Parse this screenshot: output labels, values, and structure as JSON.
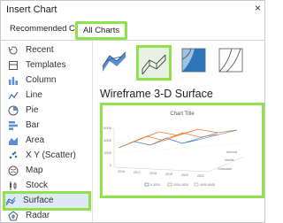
{
  "dialog": {
    "title": "Insert Chart",
    "close": "×"
  },
  "tabs": {
    "recommended": "Recommended Charts",
    "all": "All Charts"
  },
  "sidebar": {
    "items": [
      {
        "label": "Recent",
        "icon": "recent-icon"
      },
      {
        "label": "Templates",
        "icon": "templates-icon"
      },
      {
        "label": "Column",
        "icon": "column-chart-icon"
      },
      {
        "label": "Line",
        "icon": "line-chart-icon"
      },
      {
        "label": "Pie",
        "icon": "pie-chart-icon"
      },
      {
        "label": "Bar",
        "icon": "bar-chart-icon"
      },
      {
        "label": "Area",
        "icon": "area-chart-icon"
      },
      {
        "label": "X Y (Scatter)",
        "icon": "scatter-chart-icon"
      },
      {
        "label": "Map",
        "icon": "map-chart-icon"
      },
      {
        "label": "Stock",
        "icon": "stock-chart-icon"
      },
      {
        "label": "Surface",
        "icon": "surface-chart-icon",
        "selected": true
      },
      {
        "label": "Radar",
        "icon": "radar-chart-icon"
      }
    ]
  },
  "subtypes": [
    {
      "name": "3-D Surface",
      "selected": false
    },
    {
      "name": "Wireframe 3-D Surface",
      "selected": true
    },
    {
      "name": "Contour",
      "selected": false
    },
    {
      "name": "Wireframe Contour",
      "selected": false
    }
  ],
  "selected_chart_name": "Wireframe 3-D Surface",
  "preview": {
    "title": "Chart Title",
    "y_ticks": [
      "6000",
      "4000",
      "2000",
      "0"
    ],
    "x_ticks": [
      "2016",
      "2017",
      "2018",
      "2019",
      "2020",
      "2021"
    ],
    "depth_ticks": [
      "Almond",
      "Vanilla",
      "Chocolate"
    ],
    "legend": [
      "0-2000",
      "2000-4000",
      "4000-6000"
    ],
    "colors": {
      "band1": "#4472c4",
      "band2": "#ed7d31",
      "band3": "#a5a5a5"
    }
  },
  "colors": {
    "highlight": "#8ee34a",
    "selected_bg": "#dfe9f5"
  }
}
